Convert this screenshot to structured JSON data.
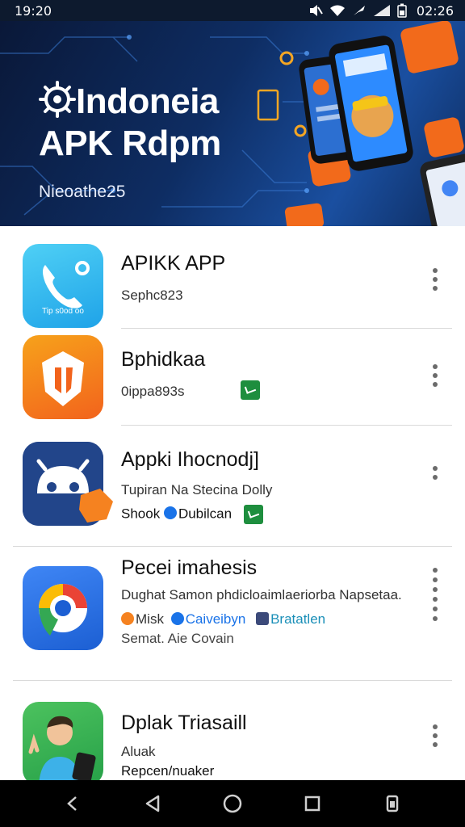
{
  "status_bar": {
    "time": "19:20",
    "right_time": "02:26",
    "icons": [
      "mute-icon",
      "wifi-icon",
      "airplane-icon",
      "signal-icon",
      "battery-icon"
    ]
  },
  "banner": {
    "title_line1": "Indoneia",
    "title_line2": "APK Rdpm",
    "subtitle": "Nieoathe25"
  },
  "apps": [
    {
      "name": "APIKK APP",
      "line1": "Sephc823",
      "icon_caption": "Tip s0od oo"
    },
    {
      "name": "Bphidkaa",
      "line1": "0ippa893s"
    },
    {
      "name": "Appki Ihocnodj]",
      "line1": "Tupiran Na Stecina Dolly",
      "line2_a": "Shook",
      "line2_b": "Dubilcan"
    },
    {
      "name": "Pecei imahesis",
      "line1": "Dughat Samon phdicloaimlaeriorba Napsetaa.",
      "line2_a": "Misk",
      "line2_b": "Caiveibyn",
      "line2_c": "Bratatlen",
      "line3": "Semat. Aie Covain"
    },
    {
      "name": "Dplak Triasaill",
      "line1": "Aluak",
      "line2": "Repcen/nuaker"
    }
  ],
  "colors": {
    "banner_bg": "#0e2d63",
    "accent_orange": "#f26a1b",
    "accent_green": "#1e8e3e",
    "accent_blue": "#1a73e8"
  }
}
